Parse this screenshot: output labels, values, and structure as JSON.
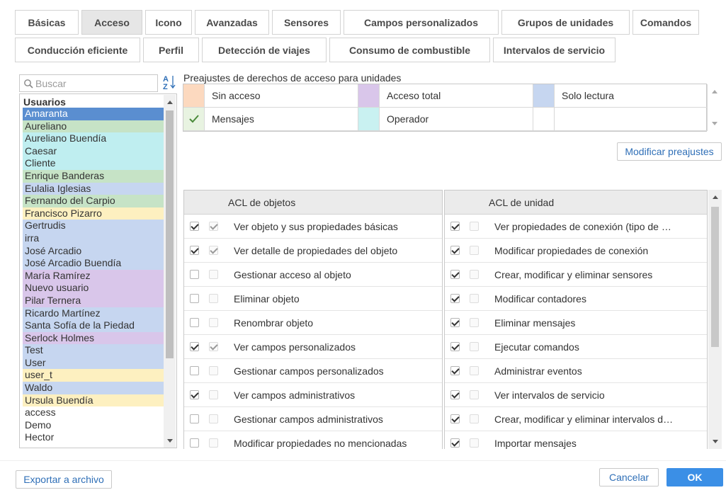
{
  "tabs": {
    "row1": [
      "Básicas",
      "Acceso",
      "Icono",
      "Avanzadas",
      "Sensores",
      "Campos personalizados",
      "Grupos de unidades",
      "Comandos"
    ],
    "row2": [
      "Conducción eficiente",
      "Perfil",
      "Detección de viajes",
      "Consumo de combustible",
      "Intervalos de servicio"
    ],
    "active": "Acceso"
  },
  "search": {
    "placeholder": "Buscar",
    "icon": "search-icon",
    "sort_icon": "sort-az-icon",
    "sort_label": "A↓Z"
  },
  "users": {
    "header": "Usuarios",
    "items": [
      {
        "name": "Amaranta",
        "color": "#5a8ed0",
        "selected": true
      },
      {
        "name": "Aureliano",
        "color": "#c6e3c6"
      },
      {
        "name": "Aureliano Buendía",
        "color": "#bfeef0"
      },
      {
        "name": "Caesar",
        "color": "#bfeef0"
      },
      {
        "name": "Cliente",
        "color": "#bfeef0"
      },
      {
        "name": "Enrique Banderas",
        "color": "#c6e3c6"
      },
      {
        "name": "Eulalia Iglesias",
        "color": "#c6d6f0"
      },
      {
        "name": "Fernando del Carpio",
        "color": "#c6e3c6"
      },
      {
        "name": "Francisco Pizarro",
        "color": "#fdf0c0"
      },
      {
        "name": "Gertrudis",
        "color": "#c6d6f0"
      },
      {
        "name": "irra",
        "color": "#c6d6f0"
      },
      {
        "name": "José Arcadio",
        "color": "#c6d6f0"
      },
      {
        "name": "José Arcadio Buendía",
        "color": "#c6d6f0"
      },
      {
        "name": "María Ramírez",
        "color": "#d9c6ea"
      },
      {
        "name": "Nuevo usuario",
        "color": "#d9c6ea"
      },
      {
        "name": "Pilar Ternera",
        "color": "#d9c6ea"
      },
      {
        "name": "Ricardo Martínez",
        "color": "#c6d6f0"
      },
      {
        "name": "Santa Sofía de la Piedad",
        "color": "#c6d6f0"
      },
      {
        "name": "Serlock Holmes",
        "color": "#d9c6ea"
      },
      {
        "name": "Test",
        "color": "#c6d6f0"
      },
      {
        "name": "User",
        "color": "#c6d6f0"
      },
      {
        "name": "user_t",
        "color": "#fdf0c0"
      },
      {
        "name": "Waldo",
        "color": "#c6d6f0"
      },
      {
        "name": "Ursula Buendía",
        "color": "#fdf0c0"
      },
      {
        "name": "access",
        "color": "#ffffff"
      },
      {
        "name": "Demo",
        "color": "#ffffff"
      },
      {
        "name": "Hector",
        "color": "#ffffff"
      }
    ]
  },
  "presets": {
    "title": "Preajustes de derechos de acceso para unidades",
    "items": [
      {
        "label": "Sin acceso",
        "color": "#fcd9bf",
        "checked": false
      },
      {
        "label": "Acceso total",
        "color": "#d9c6ea",
        "checked": false
      },
      {
        "label": "Solo lectura",
        "color": "#c6d6f0",
        "checked": false
      },
      {
        "label": "Mensajes",
        "color": "#e8f3e1",
        "checked": true
      },
      {
        "label": "Operador",
        "color": "#c9f1f1",
        "checked": false
      },
      {
        "label": "",
        "color": "#ffffff",
        "checked": false
      }
    ],
    "modify_button": "Modificar preajustes"
  },
  "acl_objects": {
    "header": "ACL de objetos",
    "rows": [
      {
        "label": "Ver objeto y sus propiedades básicas",
        "a": true,
        "b": true
      },
      {
        "label": "Ver detalle de propiedades del objeto",
        "a": true,
        "b": true
      },
      {
        "label": "Gestionar acceso al objeto",
        "a": false,
        "b": false
      },
      {
        "label": "Eliminar objeto",
        "a": false,
        "b": false
      },
      {
        "label": "Renombrar objeto",
        "a": false,
        "b": false
      },
      {
        "label": "Ver campos personalizados",
        "a": true,
        "b": true
      },
      {
        "label": "Gestionar campos personalizados",
        "a": false,
        "b": false
      },
      {
        "label": "Ver campos administrativos",
        "a": true,
        "b": false
      },
      {
        "label": "Gestionar campos administrativos",
        "a": false,
        "b": false
      },
      {
        "label": "Modificar propiedades no mencionadas",
        "a": false,
        "b": false
      }
    ]
  },
  "acl_unit": {
    "header": "ACL de unidad",
    "rows": [
      {
        "label": "Ver propiedades de conexión (tipo de …",
        "a": true,
        "b": false
      },
      {
        "label": "Modificar propiedades de conexión",
        "a": true,
        "b": false
      },
      {
        "label": "Crear, modificar y eliminar sensores",
        "a": true,
        "b": false
      },
      {
        "label": "Modificar contadores",
        "a": true,
        "b": false
      },
      {
        "label": "Eliminar mensajes",
        "a": true,
        "b": false
      },
      {
        "label": "Ejecutar comandos",
        "a": true,
        "b": false
      },
      {
        "label": "Administrar eventos",
        "a": true,
        "b": false
      },
      {
        "label": "Ver intervalos de servicio",
        "a": true,
        "b": false
      },
      {
        "label": "Crear, modificar y eliminar intervalos d…",
        "a": true,
        "b": false
      },
      {
        "label": "Importar mensajes",
        "a": true,
        "b": false
      }
    ]
  },
  "footer": {
    "export_button": "Exportar a archivo",
    "cancel_button": "Cancelar",
    "ok_button": "OK",
    "accent": "#3b8fe6"
  }
}
